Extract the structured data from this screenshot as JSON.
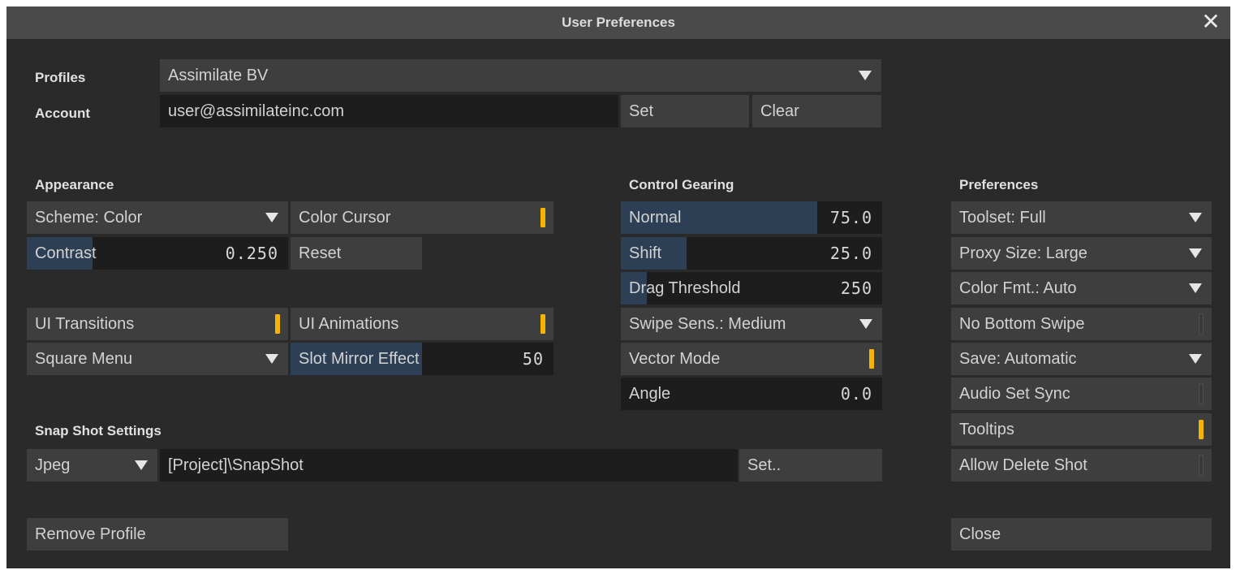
{
  "window": {
    "title": "User Preferences"
  },
  "profiles": {
    "label": "Profiles",
    "value": "Assimilate BV"
  },
  "account": {
    "label": "Account",
    "value": "user@assimilateinc.com",
    "set_label": "Set",
    "clear_label": "Clear"
  },
  "appearance": {
    "heading": "Appearance",
    "scheme": "Scheme: Color",
    "color_cursor": {
      "label": "Color Cursor",
      "on": true
    },
    "contrast": {
      "label": "Contrast",
      "value": "0.250",
      "fraction": 0.25
    },
    "reset_label": "Reset",
    "ui_transitions": {
      "label": "UI Transitions",
      "on": true
    },
    "ui_animations": {
      "label": "UI Animations",
      "on": true
    },
    "square_menu": "Square Menu",
    "slot_mirror": {
      "label": "Slot Mirror Effect",
      "value": "50",
      "fraction": 0.5
    }
  },
  "control_gearing": {
    "heading": "Control Gearing",
    "normal": {
      "label": "Normal",
      "value": "75.0",
      "fraction": 0.75
    },
    "shift": {
      "label": "Shift",
      "value": "25.0",
      "fraction": 0.25
    },
    "drag_threshold": {
      "label": "Drag Threshold",
      "value": "250",
      "fraction": 0.1
    },
    "swipe_sens": "Swipe Sens.: Medium",
    "vector_mode": {
      "label": "Vector Mode",
      "on": true
    },
    "angle": {
      "label": "Angle",
      "value": "0.0",
      "fraction": 0.0
    }
  },
  "preferences": {
    "heading": "Preferences",
    "toolset": "Toolset: Full",
    "proxy_size": "Proxy Size: Large",
    "color_fmt": "Color Fmt.: Auto",
    "no_bottom_swipe": {
      "label": "No Bottom Swipe",
      "on": false
    },
    "save": "Save: Automatic",
    "audio_set_sync": {
      "label": "Audio Set Sync",
      "on": false
    },
    "tooltips": {
      "label": "Tooltips",
      "on": true
    },
    "allow_delete_shot": {
      "label": "Allow Delete Shot",
      "on": false
    }
  },
  "snapshot": {
    "heading": "Snap Shot Settings",
    "format": "Jpeg",
    "path": "[Project]\\SnapShot",
    "set_label": "Set.."
  },
  "footer": {
    "remove_profile_label": "Remove Profile",
    "close_label": "Close"
  },
  "colors": {
    "toggle_on": "#f5b400",
    "slider_fill": "#2c3f55",
    "background": "#2a2a2a",
    "control": "#3e3e3e"
  }
}
